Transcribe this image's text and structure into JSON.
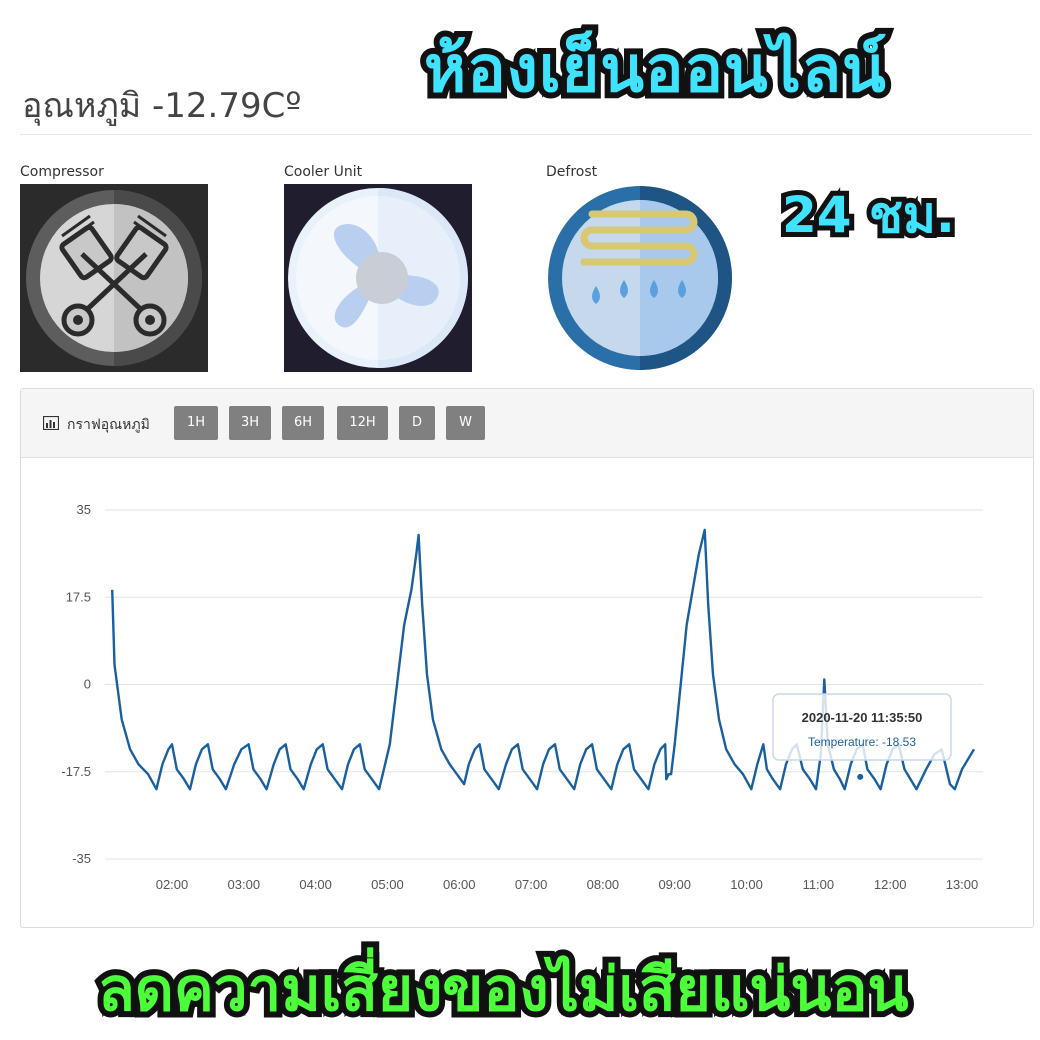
{
  "header": {
    "temperature_title": "อุณหภูมิ -12.79Cº"
  },
  "promo": {
    "title": "ห้องเย็นออนไลน์",
    "hours": "24 ชม.",
    "tagline": "ลดความเสี่ยงของไม่เสียแน่นอน"
  },
  "devices": [
    {
      "label": "Compressor",
      "icon": "compressor-pistons-icon"
    },
    {
      "label": "Cooler Unit",
      "icon": "fan-icon"
    },
    {
      "label": "Defrost",
      "icon": "defrost-coil-icon"
    }
  ],
  "graph_panel": {
    "title": "กราฟอุณหภูมิ",
    "icon": "bar-chart-icon",
    "ranges": [
      "1H",
      "3H",
      "6H",
      "12H",
      "D",
      "W"
    ]
  },
  "tooltip": {
    "title": "2020-11-20 11:35:50",
    "value": "Temperature: -18.53"
  },
  "colors": {
    "series": "#1a5f9e",
    "button": "#808080",
    "promo_cyan": "#3fe3ff",
    "promo_green": "#4dff3a"
  },
  "chart_data": {
    "type": "line",
    "title": "",
    "xlabel": "",
    "ylabel": "",
    "ylim": [
      -35,
      35
    ],
    "yticks": [
      35,
      17.5,
      0,
      -17.5,
      -35
    ],
    "xticks": [
      "02:00",
      "03:00",
      "04:00",
      "05:00",
      "06:00",
      "07:00",
      "08:00",
      "09:00",
      "10:00",
      "11:00",
      "12:00",
      "13:00"
    ],
    "grid": true,
    "legend": "none",
    "series": [
      {
        "name": "Temperature",
        "points": [
          [
            "01:10",
            19
          ],
          [
            "01:12",
            4
          ],
          [
            "01:18",
            -7
          ],
          [
            "01:25",
            -13
          ],
          [
            "01:32",
            -16
          ],
          [
            "01:40",
            -18
          ],
          [
            "01:47",
            -21
          ],
          [
            "01:52",
            -16
          ],
          [
            "01:57",
            -13
          ],
          [
            "02:00",
            -12
          ],
          [
            "02:04",
            -17
          ],
          [
            "02:10",
            -19
          ],
          [
            "02:15",
            -21
          ],
          [
            "02:20",
            -16
          ],
          [
            "02:25",
            -13
          ],
          [
            "02:30",
            -12
          ],
          [
            "02:34",
            -17
          ],
          [
            "02:40",
            -19
          ],
          [
            "02:45",
            -21
          ],
          [
            "02:52",
            -16
          ],
          [
            "02:58",
            -13
          ],
          [
            "03:04",
            -12
          ],
          [
            "03:08",
            -17
          ],
          [
            "03:14",
            -19
          ],
          [
            "03:19",
            -21
          ],
          [
            "03:25",
            -16
          ],
          [
            "03:30",
            -13
          ],
          [
            "03:35",
            -12
          ],
          [
            "03:39",
            -17
          ],
          [
            "03:45",
            -19
          ],
          [
            "03:50",
            -21
          ],
          [
            "03:56",
            -16
          ],
          [
            "04:01",
            -13
          ],
          [
            "04:06",
            -12
          ],
          [
            "04:10",
            -17
          ],
          [
            "04:16",
            -19
          ],
          [
            "04:22",
            -21
          ],
          [
            "04:27",
            -16
          ],
          [
            "04:32",
            -13
          ],
          [
            "04:37",
            -12
          ],
          [
            "04:41",
            -17
          ],
          [
            "04:47",
            -19
          ],
          [
            "04:53",
            -21
          ],
          [
            "04:57",
            -17
          ],
          [
            "05:02",
            -12
          ],
          [
            "05:08",
            0
          ],
          [
            "05:14",
            12
          ],
          [
            "05:20",
            19
          ],
          [
            "05:24",
            26
          ],
          [
            "05:26",
            30
          ],
          [
            "05:29",
            16
          ],
          [
            "05:33",
            2
          ],
          [
            "05:38",
            -7
          ],
          [
            "05:45",
            -13
          ],
          [
            "05:52",
            -16
          ],
          [
            "05:58",
            -18
          ],
          [
            "06:04",
            -20
          ],
          [
            "06:08",
            -16
          ],
          [
            "06:13",
            -13
          ],
          [
            "06:17",
            -12
          ],
          [
            "06:21",
            -17
          ],
          [
            "06:27",
            -19
          ],
          [
            "06:33",
            -21
          ],
          [
            "06:39",
            -16
          ],
          [
            "06:44",
            -13
          ],
          [
            "06:49",
            -12
          ],
          [
            "06:53",
            -17
          ],
          [
            "06:59",
            -19
          ],
          [
            "07:05",
            -21
          ],
          [
            "07:10",
            -16
          ],
          [
            "07:15",
            -13
          ],
          [
            "07:20",
            -12
          ],
          [
            "07:24",
            -17
          ],
          [
            "07:30",
            -19
          ],
          [
            "07:36",
            -21
          ],
          [
            "07:41",
            -16
          ],
          [
            "07:46",
            -13
          ],
          [
            "07:51",
            -12
          ],
          [
            "07:55",
            -17
          ],
          [
            "08:01",
            -19
          ],
          [
            "08:07",
            -21
          ],
          [
            "08:12",
            -16
          ],
          [
            "08:17",
            -13
          ],
          [
            "08:22",
            -12
          ],
          [
            "08:26",
            -17
          ],
          [
            "08:32",
            -19
          ],
          [
            "08:38",
            -21
          ],
          [
            "08:43",
            -16
          ],
          [
            "08:48",
            -13
          ],
          [
            "08:52",
            -12
          ],
          [
            "08:53",
            -19
          ],
          [
            "08:55",
            -18
          ],
          [
            "08:57",
            -18
          ],
          [
            "09:00",
            -12
          ],
          [
            "09:05",
            0
          ],
          [
            "09:10",
            12
          ],
          [
            "09:15",
            19
          ],
          [
            "09:20",
            26
          ],
          [
            "09:25",
            31
          ],
          [
            "09:28",
            16
          ],
          [
            "09:32",
            2
          ],
          [
            "09:37",
            -7
          ],
          [
            "09:43",
            -13
          ],
          [
            "09:50",
            -16
          ],
          [
            "09:57",
            -18
          ],
          [
            "10:04",
            -21
          ],
          [
            "10:09",
            -16
          ],
          [
            "10:14",
            -12
          ],
          [
            "10:17",
            -17
          ],
          [
            "10:22",
            -19
          ],
          [
            "10:28",
            -21
          ],
          [
            "10:33",
            -16
          ],
          [
            "10:38",
            -13
          ],
          [
            "10:42",
            -12
          ],
          [
            "10:47",
            -17
          ],
          [
            "10:53",
            -19
          ],
          [
            "10:58",
            -21
          ],
          [
            "11:02",
            -14
          ],
          [
            "11:05",
            1
          ],
          [
            "11:08",
            -12
          ],
          [
            "11:13",
            -17
          ],
          [
            "11:18",
            -19
          ],
          [
            "11:22",
            -21
          ],
          [
            "11:27",
            -16
          ],
          [
            "11:32",
            -13
          ],
          [
            "11:37",
            -12
          ],
          [
            "11:41",
            -17
          ],
          [
            "11:47",
            -19
          ],
          [
            "11:52",
            -21
          ],
          [
            "11:57",
            -16
          ],
          [
            "12:02",
            -13
          ],
          [
            "12:07",
            -12
          ],
          [
            "12:12",
            -17
          ],
          [
            "12:17",
            -19
          ],
          [
            "12:22",
            -21
          ],
          [
            "12:30",
            -17
          ],
          [
            "12:37",
            -14
          ],
          [
            "12:43",
            -13
          ],
          [
            "12:50",
            -20
          ],
          [
            "12:54",
            -21
          ],
          [
            "13:00",
            -17
          ],
          [
            "13:10",
            -13
          ]
        ]
      }
    ],
    "tooltip_point": {
      "x": "11:35",
      "y": -18.53
    }
  }
}
